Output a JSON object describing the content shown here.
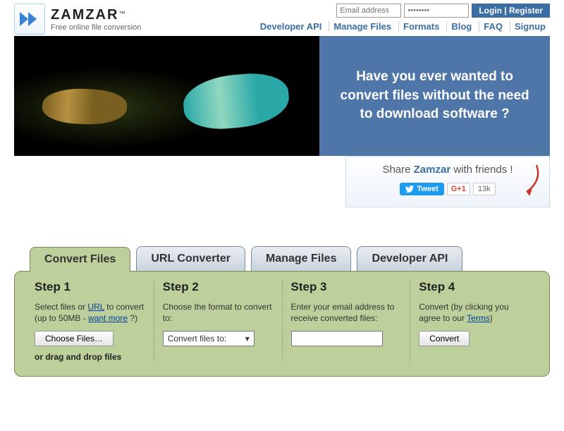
{
  "logo": {
    "title": "ZAMZAR",
    "tm": "™",
    "tagline": "Free online file conversion"
  },
  "login": {
    "email_ph": "Email address",
    "pass_ph": "••••••••",
    "login": "Login",
    "register": "Register"
  },
  "nav": [
    "Developer API",
    "Manage Files",
    "Formats",
    "Blog",
    "FAQ",
    "Signup"
  ],
  "banner": {
    "text": "Have you ever wanted to convert files without the need to download software ?"
  },
  "share": {
    "prefix": "Share ",
    "brand": "Zamzar",
    "suffix": " with friends !",
    "tweet": "Tweet",
    "gplus": "G+1",
    "count": "13k"
  },
  "tabs": [
    "Convert Files",
    "URL Converter",
    "Manage Files",
    "Developer API"
  ],
  "steps": {
    "s1": {
      "title": "Step 1",
      "desc_a": "Select files or ",
      "url": "URL",
      "desc_b": " to convert (up to 50MB - ",
      "want": "want more",
      "desc_c": " ?)",
      "btn": "Choose Files…",
      "drag": "or drag and drop files"
    },
    "s2": {
      "title": "Step 2",
      "desc": "Choose the format to convert to:",
      "select": "Convert files to:"
    },
    "s3": {
      "title": "Step 3",
      "desc": "Enter your email address to receive converted files:"
    },
    "s4": {
      "title": "Step 4",
      "desc_a": "Convert (by clicking you agree to our ",
      "terms": "Terms",
      "desc_b": ")",
      "btn": "Convert"
    }
  }
}
